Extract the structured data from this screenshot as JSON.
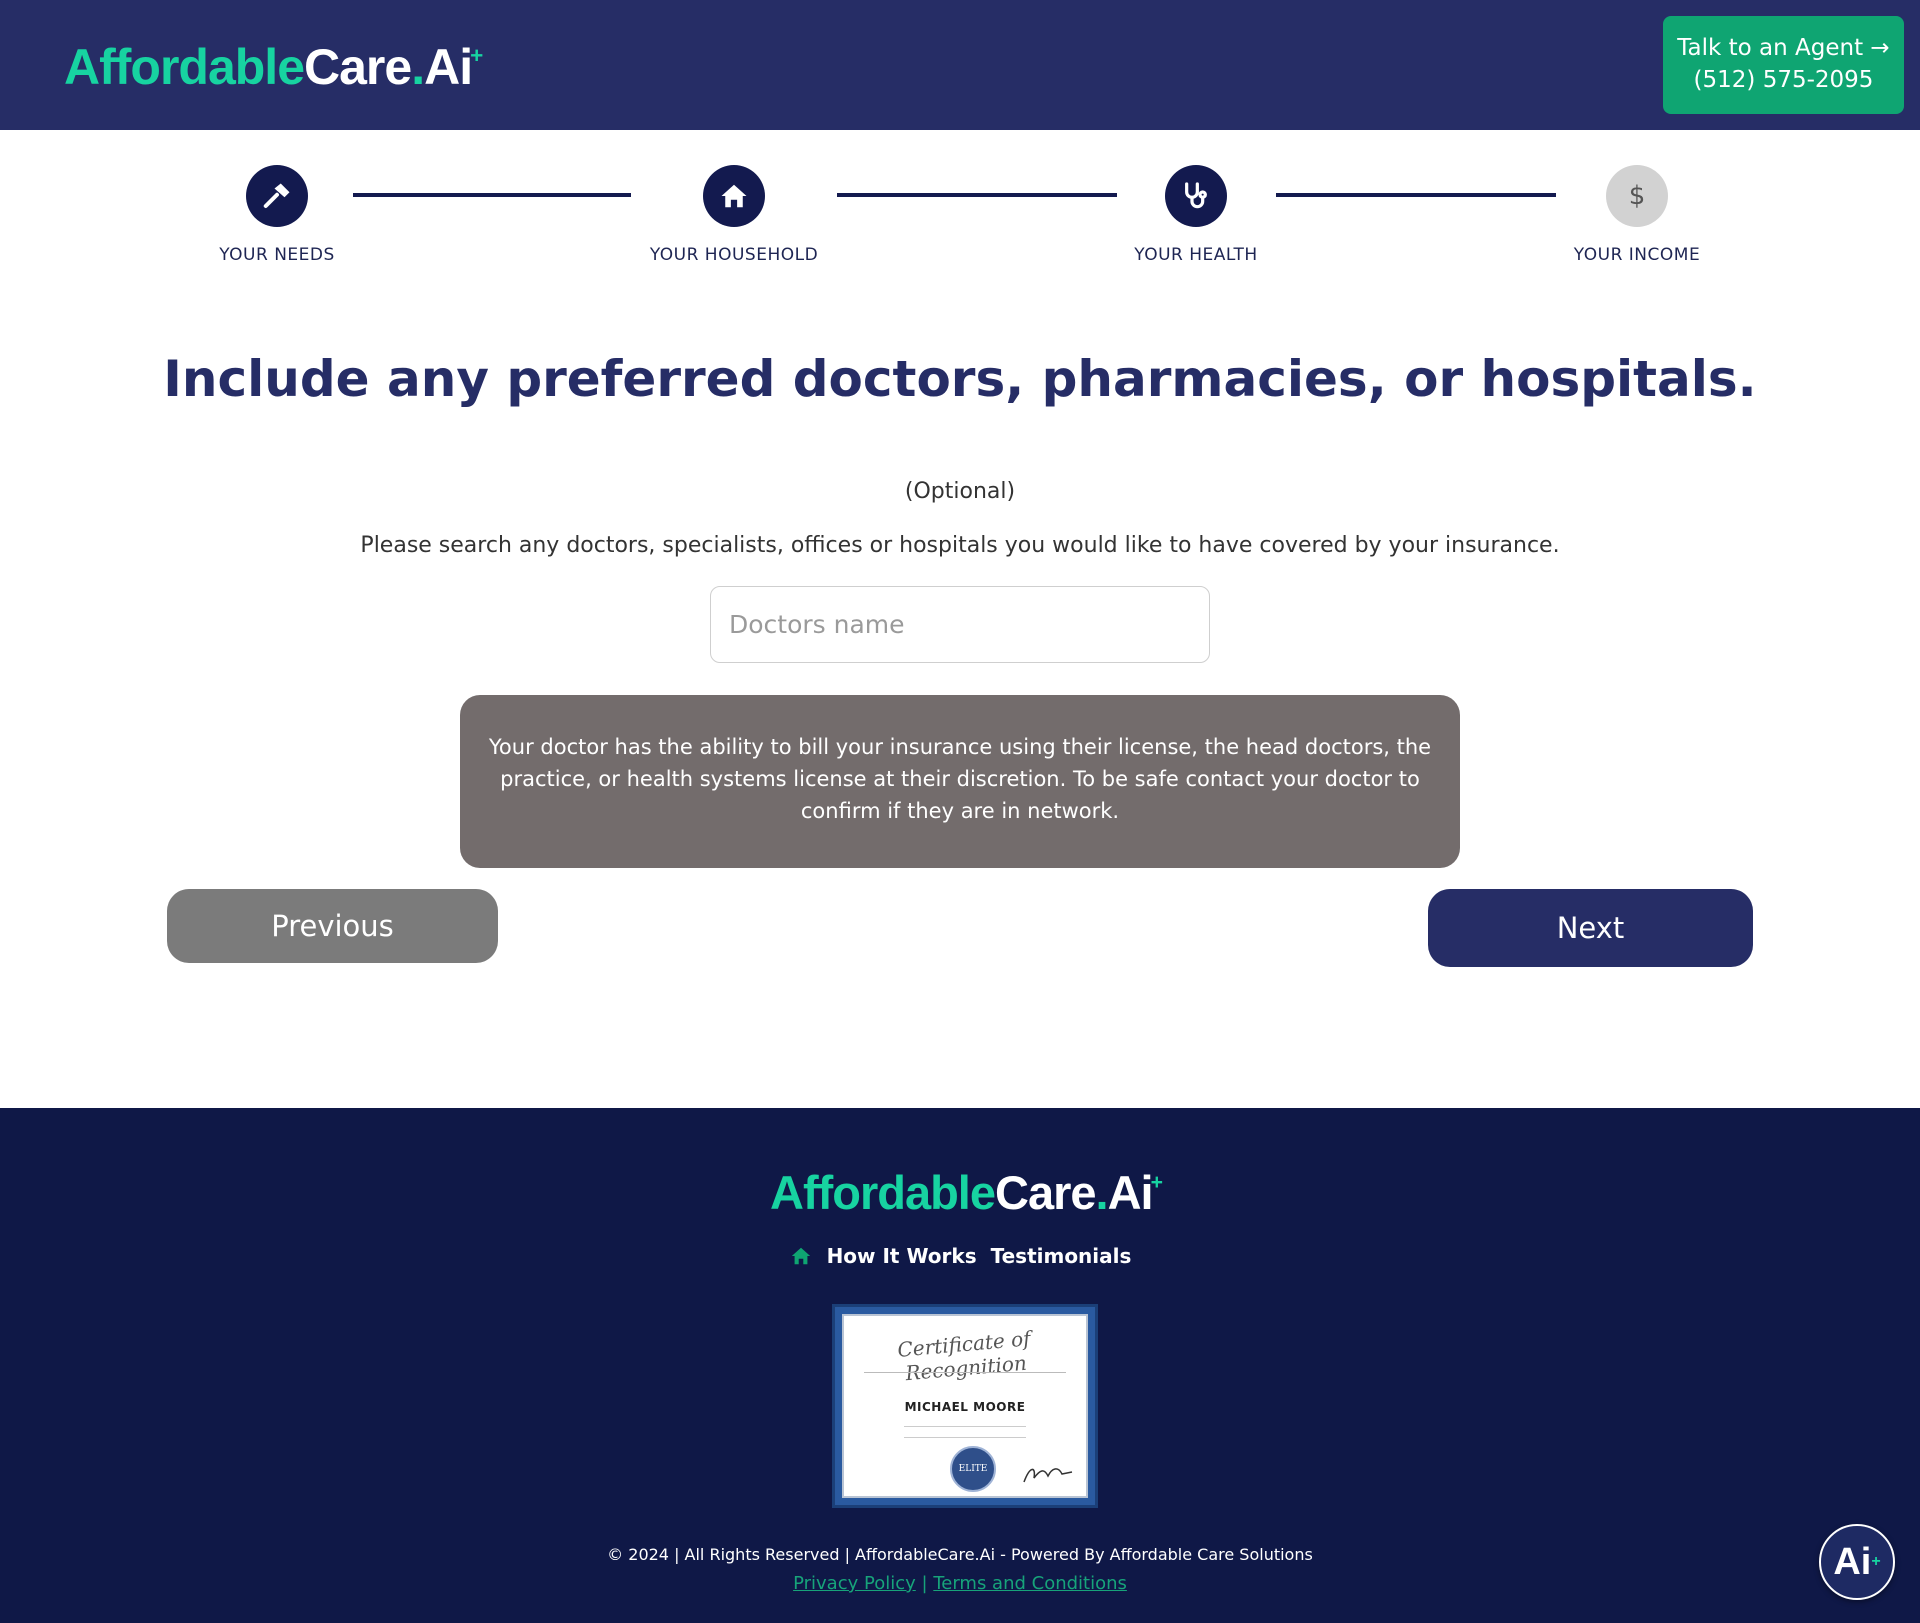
{
  "header": {
    "logo": {
      "part1": "Affordable",
      "part2": "Care",
      "dot": ".",
      "part3": "Ai",
      "plus": "+"
    },
    "agent_button": {
      "line1": "Talk to an Agent →",
      "line2": "(512) 575-2095"
    }
  },
  "stepper": {
    "steps": [
      {
        "label": "YOUR NEEDS",
        "icon": "hammer-icon",
        "status": "complete"
      },
      {
        "label": "YOUR HOUSEHOLD",
        "icon": "home-icon",
        "status": "complete"
      },
      {
        "label": "YOUR HEALTH",
        "icon": "stethoscope-icon",
        "status": "current"
      },
      {
        "label": "YOUR INCOME",
        "icon": "dollar-icon",
        "status": "upcoming"
      }
    ],
    "dollar_glyph": "$"
  },
  "main": {
    "title": "Include any preferred doctors, pharmacies, or hospitals.",
    "optional": "(Optional)",
    "instructions": "Please search any doctors, specialists, offices or hospitals you would like to have covered by your insurance.",
    "search": {
      "placeholder": "Doctors name",
      "value": ""
    },
    "notice": "Your doctor has the ability to bill your insurance using their license, the head doctors, the practice, or health systems license at their discretion. To be safe contact your doctor to confirm if they are in network.",
    "previous_label": "Previous",
    "next_label": "Next"
  },
  "footer": {
    "nav": [
      {
        "label": "How It Works"
      },
      {
        "label": "Testimonials"
      }
    ],
    "certificate": {
      "title": "Certificate of Recognition",
      "name": "MICHAEL MOORE",
      "seal": "ELITE"
    },
    "copyright": "© 2024 | All Rights Reserved | AffordableCare.Ai - Powered By Affordable Care Solutions",
    "privacy_label": "Privacy Policy",
    "separator": "|",
    "terms_label": "Terms and Conditions"
  },
  "chat_badge": {
    "label": "Ai",
    "plus": "+"
  },
  "colors": {
    "header_bg": "#262d66",
    "accent_green": "#17d3a1",
    "agent_button_bg": "#0fa572",
    "step_active": "#131a4f",
    "step_inactive": "#d2d2d2",
    "notice_bg": "#736c6c",
    "previous_bg": "#7b7b7b",
    "next_bg": "#262d66",
    "footer_bg": "#0f1847"
  }
}
